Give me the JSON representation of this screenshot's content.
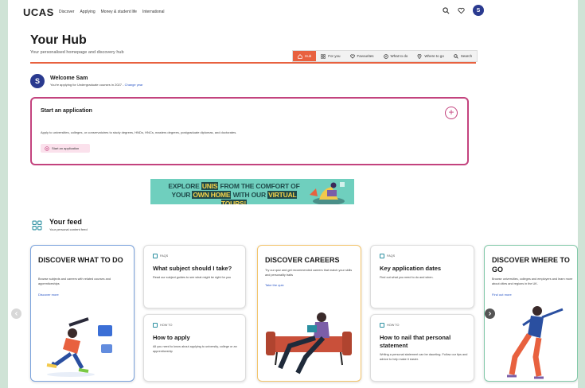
{
  "topnav": {
    "logo": "UCAS",
    "links": [
      "Discover",
      "Applying",
      "Money & student life",
      "International"
    ],
    "avatar_initial": "S",
    "icons": [
      "search-icon",
      "heart-icon",
      "avatar"
    ]
  },
  "hub": {
    "title": "Your Hub",
    "subtitle": "Your personalised homepage and discovery hub",
    "accent_color": "#e8613f",
    "tabs": [
      {
        "label": "Hub",
        "icon": "home-icon",
        "active": true
      },
      {
        "label": "For you",
        "icon": "grid-icon",
        "active": false
      },
      {
        "label": "Favourites",
        "icon": "heart-icon",
        "active": false
      },
      {
        "label": "What to do",
        "icon": "compass-icon",
        "active": false
      },
      {
        "label": "Where to go",
        "icon": "pin-icon",
        "active": false
      },
      {
        "label": "Search",
        "icon": "search-icon",
        "active": false
      }
    ]
  },
  "welcome": {
    "initial": "S",
    "title": "Welcome Sam",
    "subtitle": "You're applying for Undergraduate courses in 2027 - ",
    "link": "Change year"
  },
  "application": {
    "title": "Start an application",
    "description": "Apply to universities, colleges, or conservatoires to study degrees, HNDs, HNCs, masters degrees, postgraduate diplomas, and doctorates.",
    "button": "Start an application",
    "accent_color": "#c3437e"
  },
  "banner": {
    "line1_a": "EXPLORE ",
    "line1_hl": "UNIS",
    "line1_b": " FROM THE COMFORT OF",
    "line2_a": "YOUR ",
    "line2_hl1": "OWN HOME",
    "line2_b": " WITH OUR ",
    "line2_hl2": "VIRTUAL TOURS!"
  },
  "feed": {
    "title": "Your feed",
    "subtitle": "Your personal content feed",
    "cards": {
      "discover_what": {
        "title": "DISCOVER WHAT TO DO",
        "desc": "Browse subjects and careers with related courses and apprenticeships",
        "link": "Discover more"
      },
      "faq_subject": {
        "tag": "FAQS",
        "title": "What subject should I take?",
        "desc": "Read our subject guides to see what might be right for you"
      },
      "howto_apply": {
        "tag": "HOW TO",
        "title": "How to apply",
        "desc": "All you need to know about applying to university, college or an apprenticeship"
      },
      "discover_careers": {
        "title": "DISCOVER CAREERS",
        "desc": "Try our quiz and get recommended careers that match your skills and personality traits",
        "link": "Take the quiz"
      },
      "faq_dates": {
        "tag": "FAQS",
        "title": "Key application dates",
        "desc": "Find out what you need to do and when."
      },
      "howto_statement": {
        "tag": "HOW TO",
        "title": "How to nail that personal statement",
        "desc": "Writing a personal statement can be daunting. Follow our tips and advice to help make it easier."
      },
      "discover_where": {
        "title": "DISCOVER WHERE TO GO",
        "desc": "Browse universities, colleges and employers and learn more about cities and regions in the UK.",
        "link": "Find out more"
      }
    }
  }
}
